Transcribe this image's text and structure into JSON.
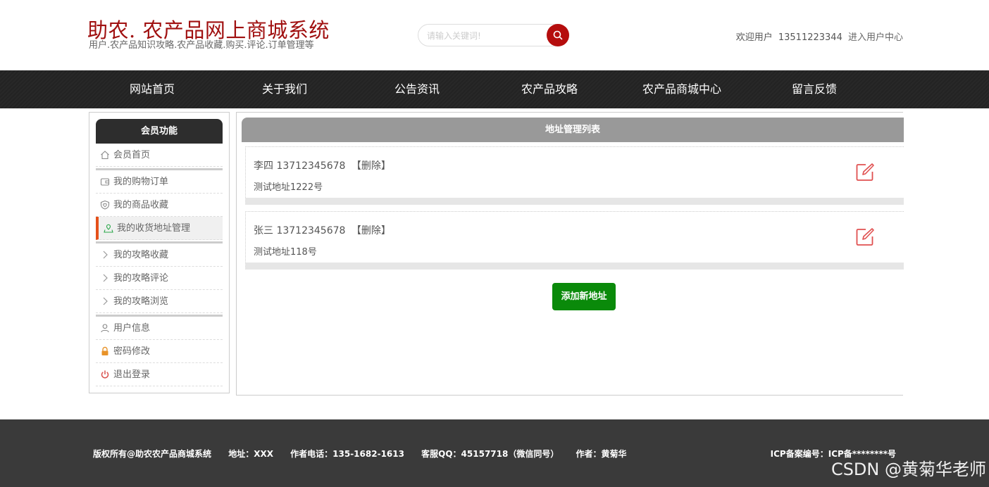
{
  "header": {
    "logo_title": "助农. 农产品网上商城系统",
    "logo_subtitle": "用户.农产品知识攻略.农产品收藏.购买.评论.订单管理等",
    "search_placeholder": "请输入关键词!",
    "welcome_label": "欢迎用户",
    "username": "13511223344",
    "user_center_link": "进入用户中心"
  },
  "nav": {
    "items": [
      {
        "label": "网站首页"
      },
      {
        "label": "关于我们"
      },
      {
        "label": "公告资讯"
      },
      {
        "label": "农产品攻略"
      },
      {
        "label": "农产品商城中心"
      },
      {
        "label": "留言反馈"
      }
    ]
  },
  "sidebar": {
    "title": "会员功能",
    "items": [
      {
        "label": "会员首页",
        "icon": "home-icon"
      },
      {
        "label": "我的购物订单",
        "icon": "wallet-icon"
      },
      {
        "label": "我的商品收藏",
        "icon": "shield-heart-icon"
      },
      {
        "label": "我的收货地址管理",
        "icon": "location-icon",
        "active": true
      },
      {
        "label": "我的攻略收藏",
        "icon": "chevron-right-icon"
      },
      {
        "label": "我的攻略评论",
        "icon": "chevron-right-icon"
      },
      {
        "label": "我的攻略浏览",
        "icon": "chevron-right-icon"
      },
      {
        "label": "用户信息",
        "icon": "user-icon"
      },
      {
        "label": "密码修改",
        "icon": "lock-icon"
      },
      {
        "label": "退出登录",
        "icon": "power-icon"
      }
    ]
  },
  "content": {
    "title": "地址管理列表",
    "addresses": [
      {
        "name": "李四",
        "phone": "13712345678",
        "delete_label": "【删除】",
        "address": "测试地址1222号"
      },
      {
        "name": "张三",
        "phone": "13712345678",
        "delete_label": "【删除】",
        "address": "测试地址118号"
      }
    ],
    "add_button": "添加新地址"
  },
  "footer": {
    "copyright": "版权所有@助农农产品商城系统",
    "address": "地址：XXX",
    "phone": "作者电话：135-1682-1613",
    "qq": "客服QQ：45157718（微信同号）",
    "author": "作者：黄菊华",
    "icp": "ICP备案编号：ICP备********号"
  },
  "watermark": "CSDN @黄菊华老师",
  "colors": {
    "brand_red": "#a01010",
    "nav_bg": "#232323",
    "add_button_green": "#0a8a0a",
    "active_marker": "#e5501a",
    "edit_icon": "#e05050"
  }
}
